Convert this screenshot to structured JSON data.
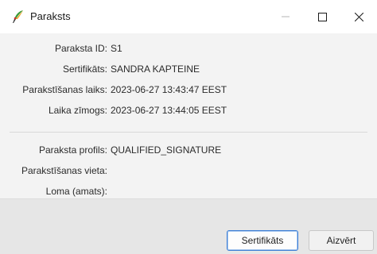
{
  "window": {
    "title": "Paraksts",
    "icon": "feather-pen-icon"
  },
  "titlebar": {
    "minimize_icon": "minimize-icon",
    "maximize_icon": "maximize-icon",
    "close_icon": "close-icon"
  },
  "fields": [
    {
      "label": "Paraksta ID:",
      "value": "S1"
    },
    {
      "label": "Sertifikāts:",
      "value": "SANDRA KAPTEINE"
    },
    {
      "label": "Parakstīšanas laiks:",
      "value": "2023-06-27 13:43:47 EEST"
    },
    {
      "label": "Laika zīmogs:",
      "value": "2023-06-27 13:44:05 EEST"
    }
  ],
  "fields2": [
    {
      "label": "Paraksta profils:",
      "value": "QUALIFIED_SIGNATURE"
    },
    {
      "label": "Parakstīšanas vieta:",
      "value": ""
    },
    {
      "label": "Loma (amats):",
      "value": ""
    }
  ],
  "buttons": {
    "certificate": "Sertifikāts",
    "close": "Aizvērt"
  },
  "colors": {
    "accent_border": "#3d7fd6",
    "window_bg": "#f3f3f3",
    "footer_bg": "#e6e6e6"
  }
}
